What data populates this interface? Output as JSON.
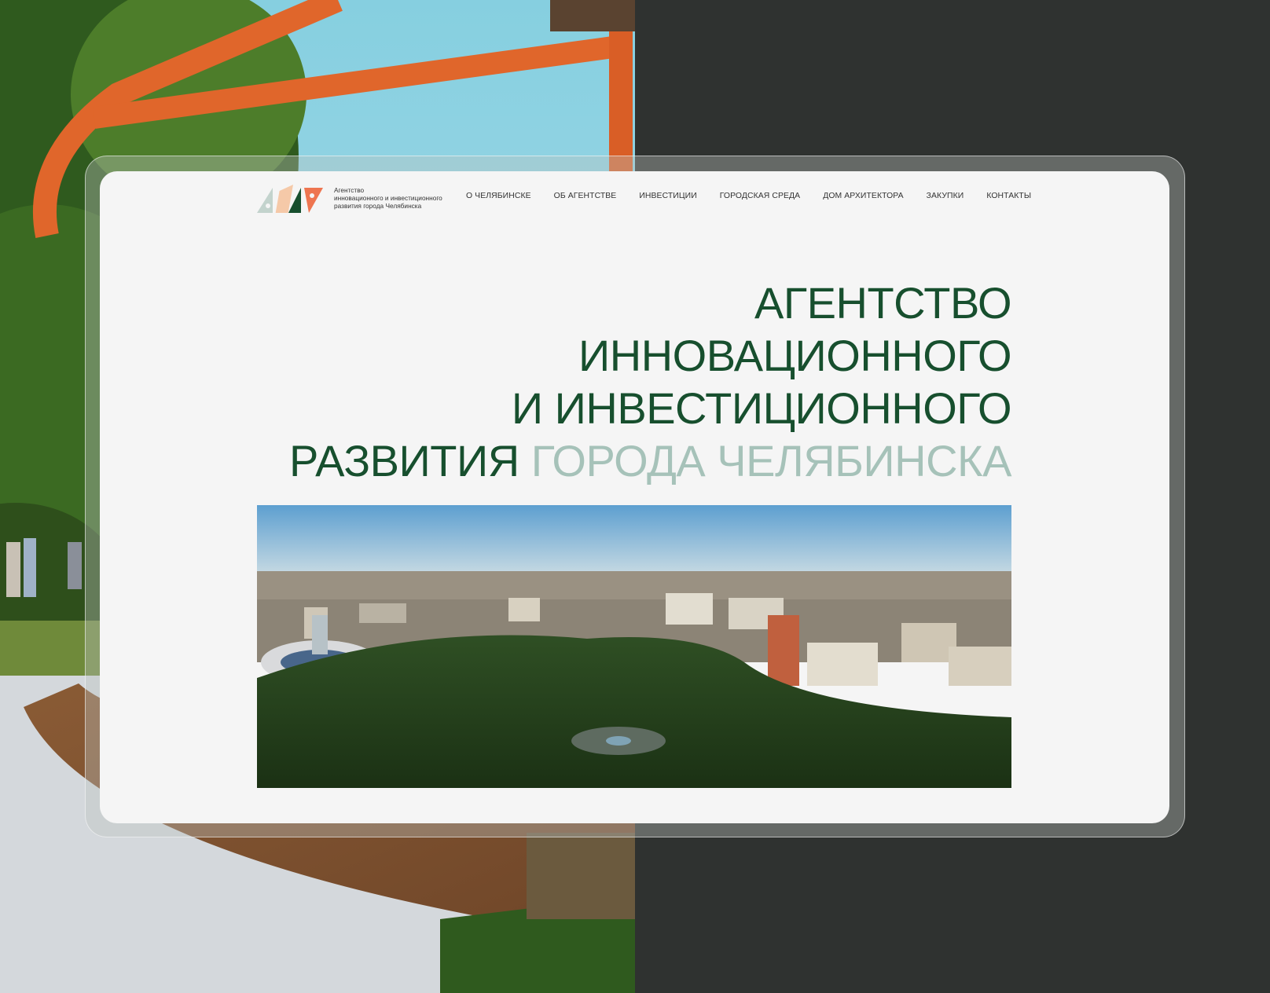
{
  "brand": {
    "name_lines": [
      "Агентство",
      "инновационного и инвестиционного",
      "развития города Челябинска"
    ],
    "logo_colors": [
      "#c3d3cd",
      "#f5c9a8",
      "#174f2e",
      "#ee7550"
    ]
  },
  "nav": {
    "items": [
      "О ЧЕЛЯБИНСКЕ",
      "ОБ АГЕНТСТВЕ",
      "ИНВЕСТИЦИИ",
      "ГОРОДСКАЯ СРЕДА",
      "ДОМ АРХИТЕКТОРА",
      "ЗАКУПКИ",
      "КОНТАКТЫ"
    ]
  },
  "hero": {
    "line1": "АГЕНТСТВО",
    "line2": "ИННОВАЦИОННОГО",
    "line3": "И ИНВЕСТИЦИОННОГО",
    "line4_dark": "РАЗВИТИЯ",
    "line4_light": "ГОРОДА ЧЕЛЯБИНСКА"
  },
  "colors": {
    "accent_dark": "#174f2e",
    "accent_light": "#a6c2b9",
    "outer_bg": "#2f3230",
    "screen_bg": "#f5f5f5"
  }
}
